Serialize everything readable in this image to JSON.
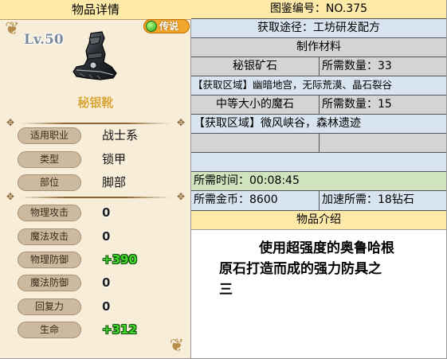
{
  "left_panel": {
    "header": "物品详情",
    "level": "Lv.50",
    "rarity": "传说",
    "item_name": "秘银靴",
    "attributes": [
      {
        "label": "适用职业",
        "value": "战士系"
      },
      {
        "label": "类型",
        "value": "锁甲"
      },
      {
        "label": "部位",
        "value": "脚部"
      }
    ],
    "stats": [
      {
        "label": "物理攻击",
        "value": "0",
        "bonus": false
      },
      {
        "label": "魔法攻击",
        "value": "0",
        "bonus": false
      },
      {
        "label": "物理防御",
        "value": "+390",
        "bonus": true
      },
      {
        "label": "魔法防御",
        "value": "0",
        "bonus": false
      },
      {
        "label": "回复力",
        "value": "0",
        "bonus": false
      },
      {
        "label": "生命",
        "value": "+312",
        "bonus": true
      }
    ]
  },
  "right_panel": {
    "codex": "图鉴编号：NO.375",
    "source": "获取途径：工坊研发配方",
    "materials_header": "制作材料",
    "material1": {
      "name": "秘银矿石",
      "qty": "所需数量：33",
      "area": "【获取区域】幽暗地宫，无际荒漠、晶石裂谷"
    },
    "material2": {
      "name": "中等大小的魔石",
      "qty": "所需数量：15",
      "area": "【获取区域】微风峡谷，森林遗迹"
    },
    "time": "所需时间：00:08:45",
    "gold": "所需金币：8600",
    "speedup": "加速所需：18钻石",
    "intro_header": "物品介绍",
    "description_line1": "使用超强度的奥鲁哈根",
    "description_line2": "原石打造而成的强力防具之",
    "description_line3": "三"
  },
  "colors": {
    "header_yellow": "#fde9a8",
    "light_blue": "#d8e4ef",
    "gray": "#d4d4d4",
    "green": "#cfe3bd",
    "bonus_green": "#3fd82a",
    "item_name_gold": "#d8a53a"
  },
  "icons": [
    "ornament-corner-icon",
    "legendary-badge-icon",
    "mithril-boot-icon"
  ]
}
